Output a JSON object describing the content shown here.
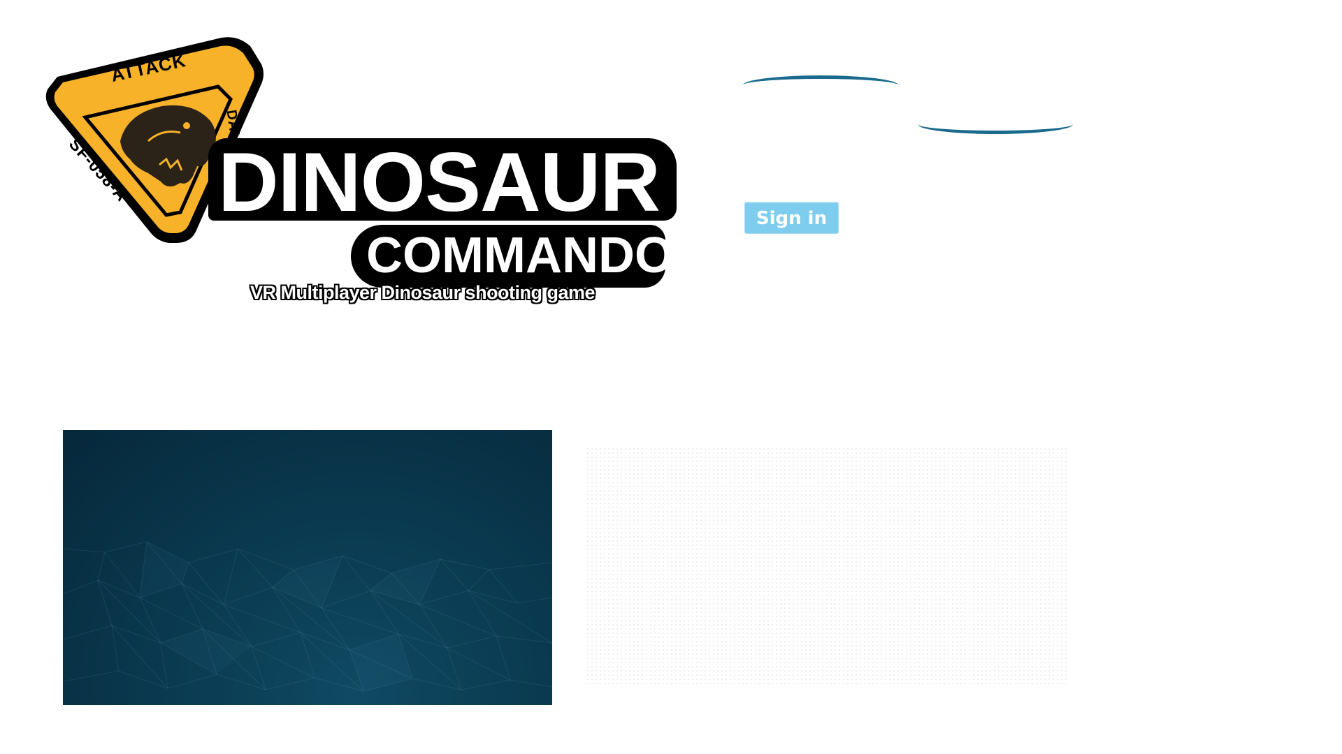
{
  "logo": {
    "badge_top_text": "ATTACK",
    "badge_left_text": "SF-058-A",
    "badge_right_text": "DANGER",
    "title": "DINOSAUR",
    "subtitle": "COMMANDO",
    "tagline": "VR Multiplayer  Dinosaur shooting game"
  },
  "header": {
    "signin_label": "Sign in"
  },
  "colors": {
    "badge_yellow": "#f7b22a",
    "accent_blue": "#1a6a8e",
    "signin_bg": "#7fcdee",
    "panel_dark": "#06283a"
  }
}
